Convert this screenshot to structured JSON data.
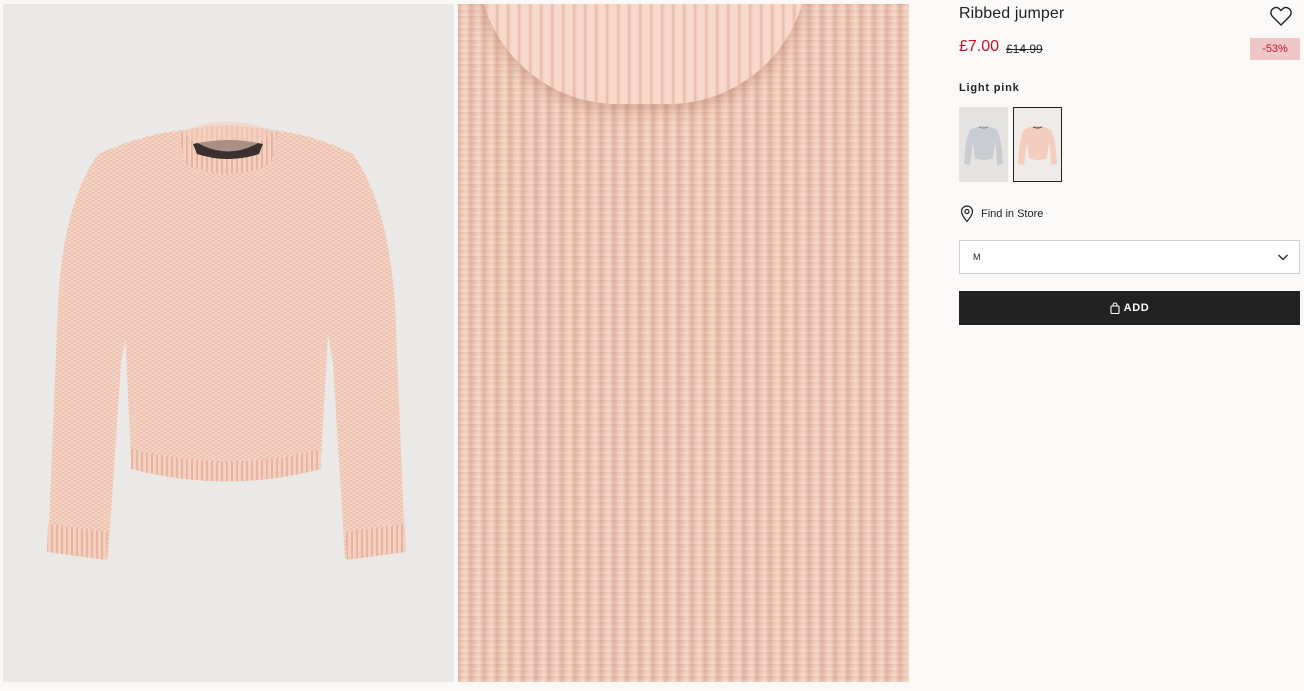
{
  "product": {
    "title": "Ribbed jumper",
    "price": "£7.00",
    "old_price": "£14.99",
    "discount": "-53%",
    "color_name": "Light pink"
  },
  "swatches": [
    {
      "color": "grey",
      "icon": "grey-jumper-thumbnail",
      "selected": false
    },
    {
      "color": "light-pink",
      "icon": "pink-jumper-thumbnail",
      "selected": true
    }
  ],
  "find_store": {
    "label": "Find in Store",
    "icon": "location-pin-icon"
  },
  "size_select": {
    "value": "M",
    "icon": "chevron-down-icon"
  },
  "add_button": {
    "label": "ADD",
    "icon": "bag-icon"
  },
  "colors": {
    "sale_red": "#c8102e",
    "discount_bg": "#efc7c7",
    "button_bg": "#222222",
    "sweater_pink": "#f3cdbd"
  }
}
